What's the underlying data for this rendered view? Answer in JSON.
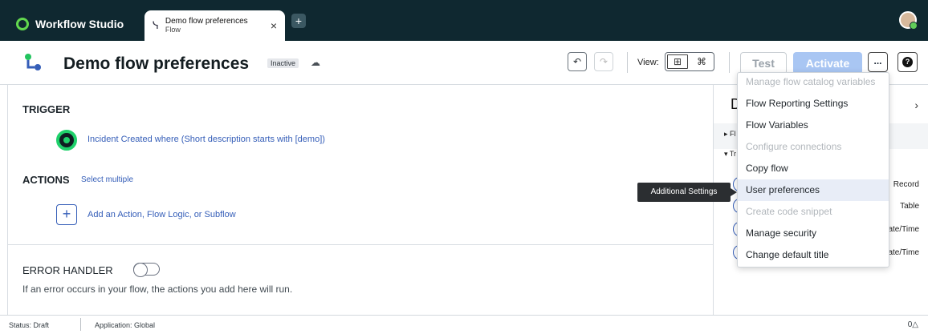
{
  "app": {
    "brand": "Workflow Studio",
    "tab_title": "Demo flow preferences",
    "tab_subtitle": "Flow",
    "new_tab": "+"
  },
  "header": {
    "title": "Demo flow preferences",
    "status": "Inactive",
    "view_label": "View:",
    "test_label": "Test",
    "activate_label": "Activate",
    "more_label": "...",
    "help_label": "?"
  },
  "main": {
    "trigger_heading": "TRIGGER",
    "trigger_text": "Incident Created where (Short description starts with [demo])",
    "actions_heading": "ACTIONS",
    "select_multiple": "Select multiple",
    "add_action": "Add an Action, Flow Logic, or Subflow",
    "error_heading": "ERROR HANDLER",
    "error_desc": "If an error occurs in your flow, the actions you add here will run."
  },
  "right_pane": {
    "title": "D",
    "row_f": "▸ Fl",
    "row_t": "▾ Tr",
    "values": [
      "Record",
      "Table",
      "ate/Time",
      "ate/Time"
    ]
  },
  "menu": {
    "items": [
      {
        "label": "Manage flow catalog variables",
        "disabled": true
      },
      {
        "label": "Flow Reporting Settings",
        "disabled": false
      },
      {
        "label": "Flow Variables",
        "disabled": false
      },
      {
        "label": "Configure connections",
        "disabled": true
      },
      {
        "label": "Copy flow",
        "disabled": false
      },
      {
        "label": "User preferences",
        "disabled": false
      },
      {
        "label": "Create code snippet",
        "disabled": true
      },
      {
        "label": "Manage security",
        "disabled": false
      },
      {
        "label": "Change default title",
        "disabled": false
      }
    ]
  },
  "tooltip": "Additional Settings",
  "statusbar": {
    "status": "Status: Draft",
    "application": "Application: Global",
    "right": "0△"
  }
}
